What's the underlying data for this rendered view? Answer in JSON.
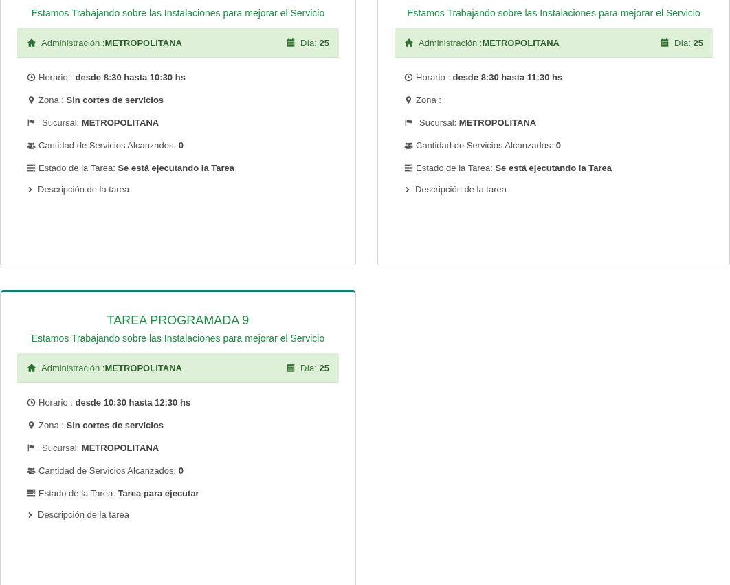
{
  "cards": [
    {
      "cut_off_top": true,
      "subtitle": "Estamos Trabajando sobre las Instalaciones para mejorar el Servicio",
      "admin_label": "Administración :",
      "admin_value": "METROPOLITANA",
      "day_label": "Día:",
      "day_value": "25",
      "details": [
        {
          "kind": "clock",
          "label": "Horario :",
          "value": "desde 8:30 hasta 10:30 hs"
        },
        {
          "kind": "pin",
          "label": "Zona :",
          "value": "Sin cortes de servicios"
        },
        {
          "kind": "flag",
          "label": "Sucursal:",
          "value": "METROPOLITANA"
        },
        {
          "kind": "users",
          "label": "Cantidad de Servicios Alcanzados:",
          "value": "0"
        },
        {
          "kind": "tasks",
          "label": "Estado de la Tarea:",
          "value": "Se está ejecutando la Tarea"
        }
      ],
      "description": {
        "label": "Descripción de la tarea",
        "expanded": false
      }
    },
    {
      "cut_off_top": true,
      "subtitle": "Estamos Trabajando sobre las Instalaciones para mejorar el Servicio",
      "admin_label": "Administración :",
      "admin_value": "METROPOLITANA",
      "day_label": "Día:",
      "day_value": "25",
      "details": [
        {
          "kind": "clock",
          "label": "Horario :",
          "value": "desde 8:30 hasta 11:30 hs"
        },
        {
          "kind": "pin",
          "label": "Zona :"
        },
        {
          "kind": "flag",
          "label": "Sucursal:",
          "value": "METROPOLITANA"
        },
        {
          "kind": "users",
          "label": "Cantidad de Servicios Alcanzados:",
          "value": "0"
        },
        {
          "kind": "tasks",
          "label": "Estado de la Tarea:",
          "value": "Se está ejecutando la Tarea"
        }
      ],
      "description": {
        "label": "Descripción de la tarea",
        "expanded": false
      }
    },
    {
      "cut_off_top": false,
      "title": "TAREA PROGRAMADA 9",
      "subtitle": "Estamos Trabajando sobre las Instalaciones para mejorar el Servicio",
      "admin_label": "Administración :",
      "admin_value": "METROPOLITANA",
      "day_label": "Día:",
      "day_value": "25",
      "details": [
        {
          "kind": "clock",
          "label": "Horario :",
          "value": "desde 10:30 hasta 12:30 hs"
        },
        {
          "kind": "pin",
          "label": "Zona :",
          "value": "Sin cortes de servicios"
        },
        {
          "kind": "flag",
          "label": "Sucursal:",
          "value": "METROPOLITANA"
        },
        {
          "kind": "users",
          "label": "Cantidad de Servicios Alcanzados:",
          "value": "0"
        },
        {
          "kind": "tasks",
          "label": "Estado de la Tarea:",
          "value": "Tarea para ejecutar"
        }
      ],
      "description": {
        "label": "Descripción de la tarea",
        "expanded": false
      }
    }
  ]
}
